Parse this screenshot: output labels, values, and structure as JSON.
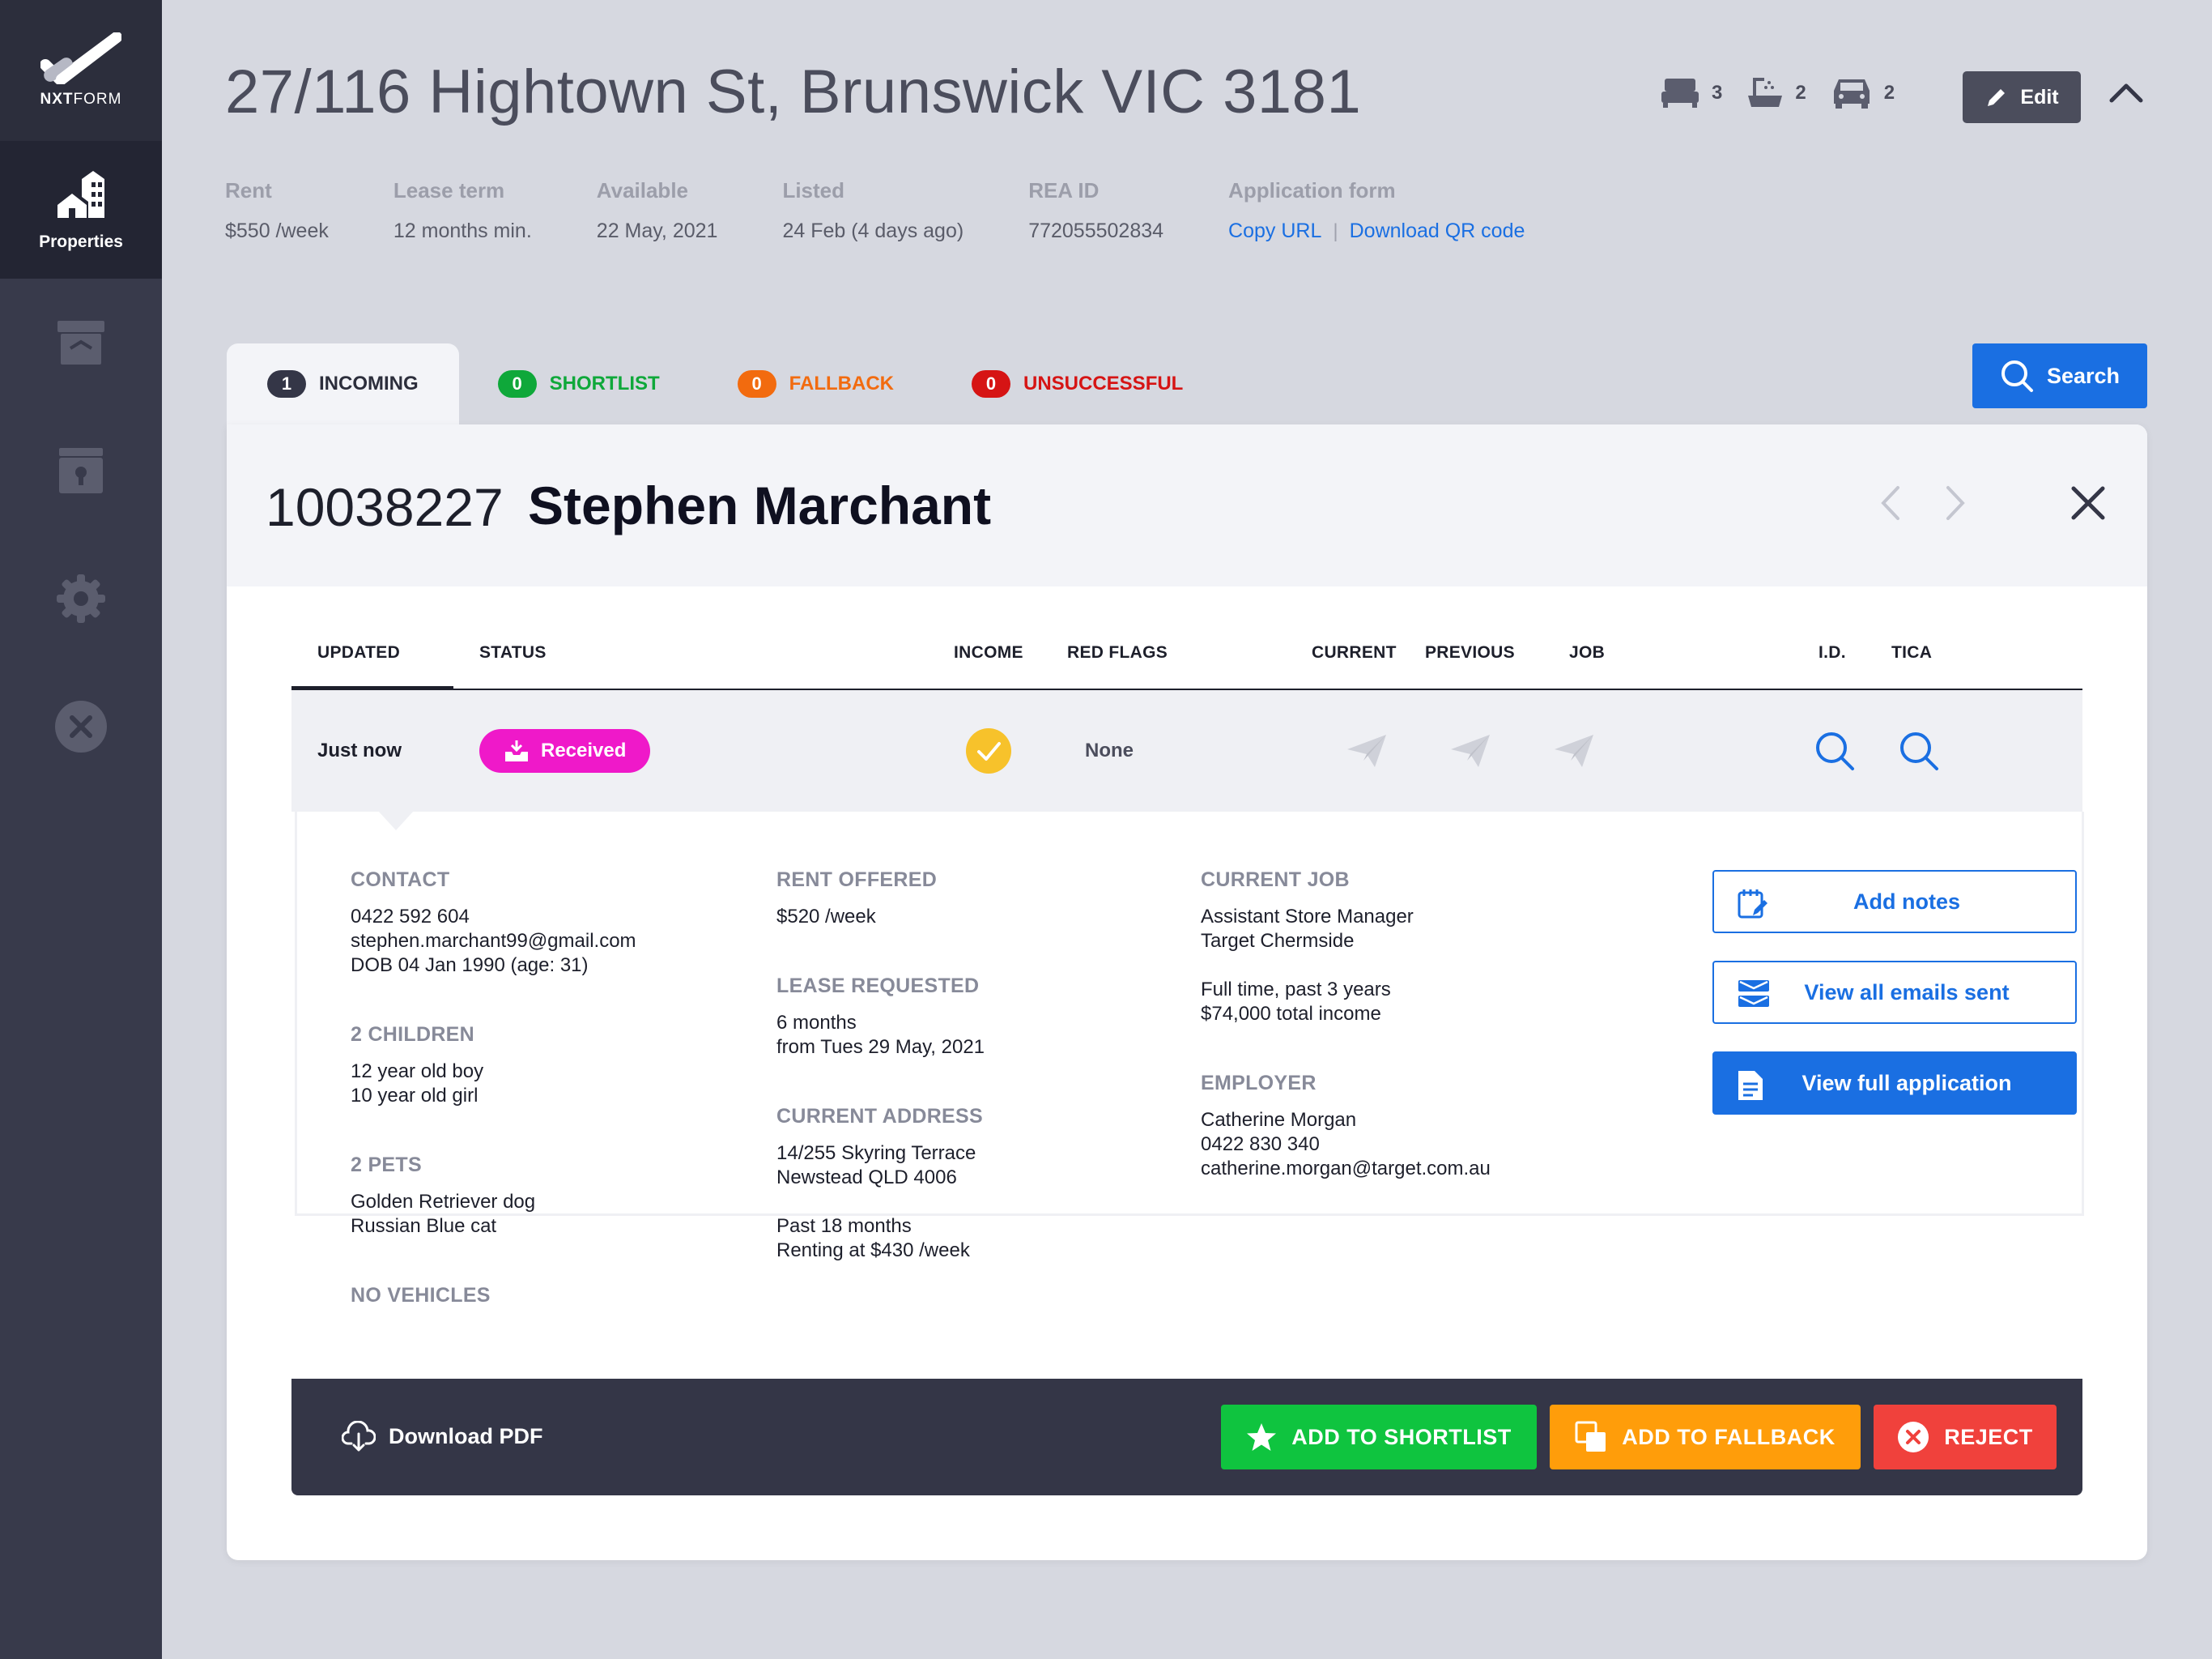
{
  "brand": {
    "logo_text_bold": "NXT",
    "logo_text": "FORM"
  },
  "sidebar": {
    "active": {
      "label": "Properties",
      "icon": "buildings-icon"
    },
    "items": [
      {
        "icon": "archive-icon"
      },
      {
        "icon": "lockbox-icon"
      },
      {
        "icon": "gear-icon"
      },
      {
        "icon": "close-circle-icon"
      }
    ]
  },
  "property": {
    "address": "27/116 Hightown St, Brunswick VIC 3181",
    "bedrooms": "3",
    "bathrooms": "2",
    "parking": "2",
    "edit_label": "Edit"
  },
  "meta": {
    "rent_label": "Rent",
    "rent_value": "$550 /week",
    "lease_label": "Lease term",
    "lease_value": "12 months min.",
    "available_label": "Available",
    "available_value": "22 May, 2021",
    "listed_label": "Listed",
    "listed_value": "24 Feb (4 days ago)",
    "rea_label": "REA ID",
    "rea_value": "772055502834",
    "form_label": "Application form",
    "copy_url": "Copy URL",
    "separator": "|",
    "download_qr": "Download QR code"
  },
  "tabs": [
    {
      "count": "1",
      "label": "INCOMING",
      "color": "#2c2e3c"
    },
    {
      "count": "0",
      "label": "SHORTLIST",
      "color": "#0fa83a"
    },
    {
      "count": "0",
      "label": "FALLBACK",
      "color": "#f26b0f"
    },
    {
      "count": "0",
      "label": "UNSUCCESSFUL",
      "color": "#d61414"
    }
  ],
  "search_label": "Search",
  "applicant": {
    "id": "10038227",
    "name": "Stephen Marchant"
  },
  "table": {
    "headers": [
      "UPDATED",
      "STATUS",
      "INCOME",
      "RED FLAGS",
      "CURRENT",
      "PREVIOUS",
      "JOB",
      "I.D.",
      "TICA"
    ],
    "row": {
      "updated": "Just now",
      "status": "Received",
      "red_flags": "None"
    }
  },
  "details": {
    "contact_label": "CONTACT",
    "phone": "0422 592 604",
    "email": "stephen.marchant99@gmail.com",
    "dob": "DOB 04 Jan 1990 (age: 31)",
    "children_label": "2 CHILDREN",
    "child1": "12 year old boy",
    "child2": "10 year old girl",
    "pets_label": "2 PETS",
    "pet1": "Golden Retriever dog",
    "pet2": "Russian Blue cat",
    "vehicles_label": "NO VEHICLES",
    "rent_offered_label": "RENT OFFERED",
    "rent_offered": "$520 /week",
    "lease_requested_label": "LEASE REQUESTED",
    "lease_duration": "6 months",
    "lease_from": "from Tues 29 May, 2021",
    "current_address_label": "CURRENT ADDRESS",
    "addr_line1": "14/255 Skyring Terrace",
    "addr_line2": "Newstead QLD 4006",
    "addr_period": "Past 18 months",
    "addr_rent": "Renting at $430 /week",
    "current_job_label": "CURRENT JOB",
    "job_title": "Assistant Store Manager",
    "job_company": "Target Chermside",
    "job_type": "Full time, past 3 years",
    "job_income": "$74,000 total income",
    "employer_label": "EMPLOYER",
    "employer_name": "Catherine Morgan",
    "employer_phone": "0422 830 340",
    "employer_email": "catherine.morgan@target.com.au"
  },
  "actions": {
    "add_notes": "Add notes",
    "view_emails": "View all emails sent",
    "view_application": "View full application"
  },
  "footer": {
    "download_pdf": "Download PDF",
    "shortlist": "ADD TO SHORTLIST",
    "fallback": "ADD TO FALLBACK",
    "reject": "REJECT"
  },
  "colors": {
    "accent": "#1a6fe2",
    "status_received": "#ef19c9",
    "income_ok": "#f7c22b",
    "shortlist": "#0fc43f",
    "fallback": "#ff9d0a",
    "reject": "#f0413c"
  }
}
